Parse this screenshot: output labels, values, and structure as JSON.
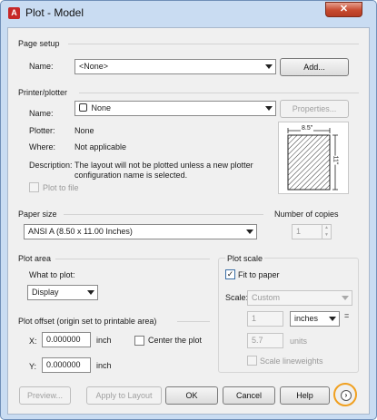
{
  "window": {
    "title": "Plot - Model",
    "close_glyph": "✕"
  },
  "page_setup": {
    "section_title": "Page setup",
    "name_label": "Name:",
    "name_value": "<None>",
    "add_button": "Add..."
  },
  "printer": {
    "section_title": "Printer/plotter",
    "name_label": "Name:",
    "name_value": "None",
    "properties_button": "Properties...",
    "plotter_label": "Plotter:",
    "plotter_value": "None",
    "where_label": "Where:",
    "where_value": "Not applicable",
    "description_label": "Description:",
    "description_line1": "The layout will not be plotted unless a new plotter",
    "description_line2": "configuration name is selected.",
    "plot_to_file_label": "Plot to file",
    "preview_width": "8.5\"",
    "preview_height": "11\""
  },
  "paper_size": {
    "section_title": "Paper size",
    "value": "ANSI A (8.50 x 11.00 Inches)"
  },
  "copies": {
    "section_title": "Number of copies",
    "value": "1"
  },
  "plot_area": {
    "section_title": "Plot area",
    "what_label": "What to plot:",
    "what_value": "Display"
  },
  "plot_offset": {
    "section_title": "Plot offset (origin set to printable area)",
    "x_label": "X:",
    "x_value": "0.000000",
    "x_unit": "inch",
    "y_label": "Y:",
    "y_value": "0.000000",
    "y_unit": "inch",
    "center_label": "Center the plot"
  },
  "plot_scale": {
    "section_title": "Plot scale",
    "fit_label": "Fit to paper",
    "fit_checked": "✓",
    "scale_label": "Scale:",
    "scale_value": "Custom",
    "top_value": "1",
    "units_value": "inches",
    "equals": "=",
    "bottom_value": "5.7",
    "bottom_unit": "units",
    "lineweights_label": "Scale lineweights"
  },
  "footer": {
    "preview_button": "Preview...",
    "apply_button": "Apply to Layout",
    "ok_button": "OK",
    "cancel_button": "Cancel",
    "help_button": "Help",
    "more_glyph": "›"
  }
}
